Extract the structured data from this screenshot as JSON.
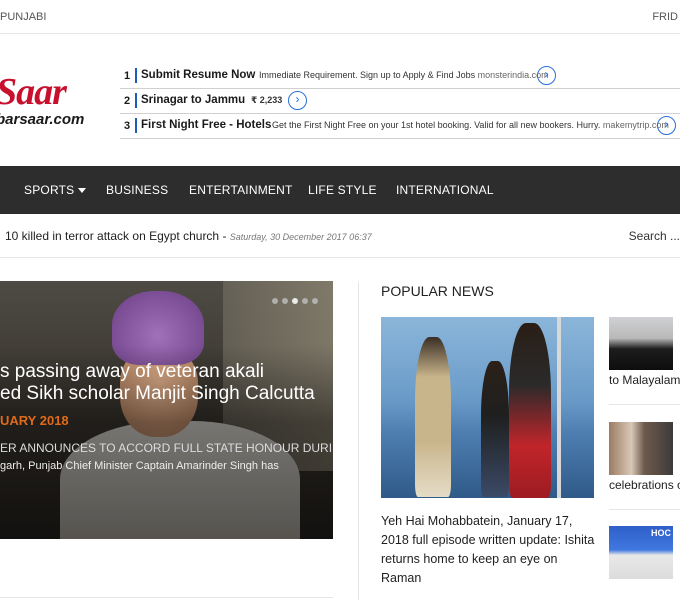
{
  "topbar": {
    "left": "PUNJABI",
    "right": "FRID"
  },
  "logo": {
    "main": "Saar",
    "sub": "barsaar.com"
  },
  "ads": [
    {
      "num": "1",
      "title": "Submit Resume Now",
      "desc": "Immediate Requirement. Sign up to Apply & Find Jobs",
      "domain": "monsterindia.com",
      "go": "›"
    },
    {
      "num": "2",
      "title": "Srinagar to Jammu",
      "desc": "₹ 2,233",
      "domain": "",
      "go": "›"
    },
    {
      "num": "3",
      "title": "First Night Free - Hotels",
      "desc": "Get the First Night Free on your 1st hotel booking. Valid for all new bookers. Hurry.",
      "domain": "makemytrip.com",
      "go": "›"
    }
  ],
  "nav": {
    "items": [
      "SPORTS",
      "BUSINESS",
      "ENTERTAINMENT",
      "LIFE STYLE",
      "INTERNATIONAL"
    ]
  },
  "ticker": {
    "headline": "10 killed in terror attack on Egypt church - ",
    "date": "Saturday, 30 December 2017 06:37",
    "search": "Search ..."
  },
  "slider": {
    "line1": "s passing away of veteran akali",
    "line2": "ed Sikh scholar Manjit Singh Calcutta",
    "date": "UARY 2018",
    "sub1": "ER ANNOUNCES TO ACCORD FULL STATE HONOUR DURING HIS",
    "sub2": "garh, Punjab Chief Minister Captain Amarinder Singh has"
  },
  "popular": {
    "title": "POPULAR NEWS",
    "feature_title": "Yeh Hai Mohabbatein, January 17, 2018 full episode written update: Ishita returns home to keep an eye on Raman",
    "side": [
      "to Malayalam i",
      "celebrations of"
    ],
    "thumb3_tag": "HOC"
  }
}
